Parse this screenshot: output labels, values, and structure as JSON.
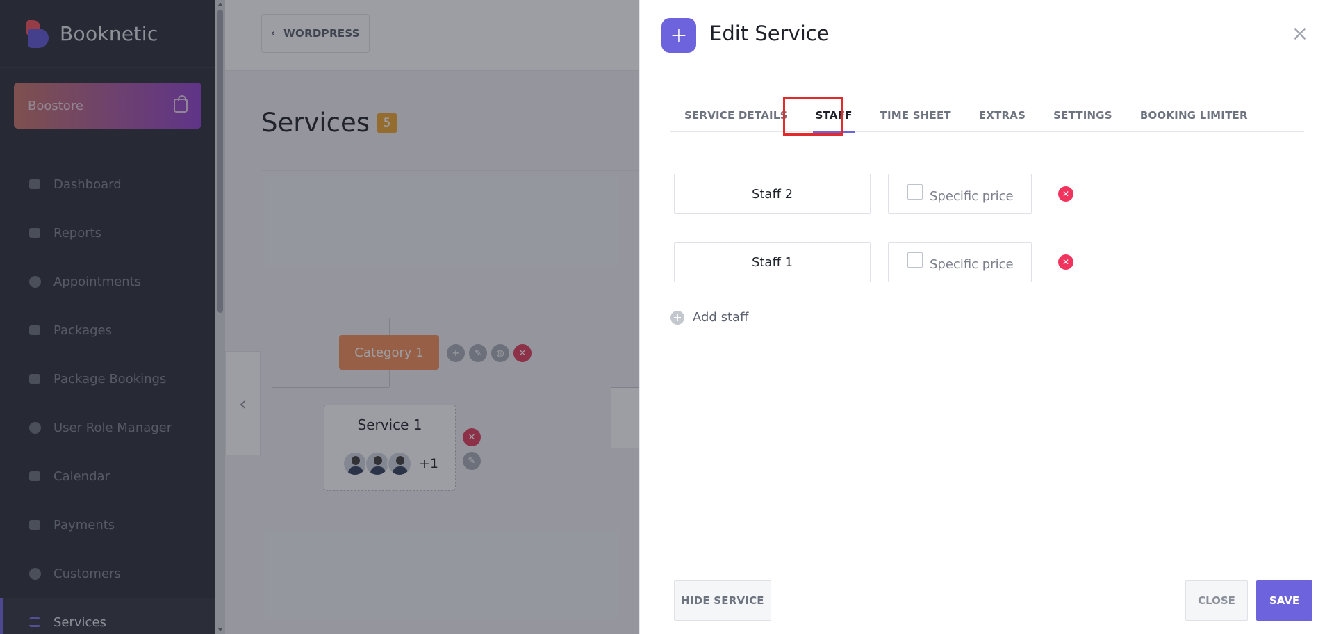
{
  "sidebar": {
    "brand": "Booknetic",
    "boostore_label": "Boostore",
    "items": [
      {
        "label": "Dashboard",
        "icon": "cube-icon"
      },
      {
        "label": "Reports",
        "icon": "chart-icon"
      },
      {
        "label": "Appointments",
        "icon": "clock-icon"
      },
      {
        "label": "Packages",
        "icon": "boxes-icon"
      },
      {
        "label": "Package Bookings",
        "icon": "box-icon"
      },
      {
        "label": "User Role Manager",
        "icon": "user-plus-icon"
      },
      {
        "label": "Calendar",
        "icon": "calendar-icon"
      },
      {
        "label": "Payments",
        "icon": "wallet-icon"
      },
      {
        "label": "Customers",
        "icon": "users-icon"
      },
      {
        "label": "Services",
        "icon": "list-icon"
      }
    ]
  },
  "background": {
    "wordpress_label": "WORDPRESS",
    "page_title": "Services",
    "count": "5",
    "category_label": "Category 1",
    "service_name": "Service 1",
    "extra_staff": "+1"
  },
  "panel": {
    "title": "Edit Service",
    "tabs": [
      "SERVICE DETAILS",
      "STAFF",
      "TIME SHEET",
      "EXTRAS",
      "SETTINGS",
      "BOOKING LIMITER"
    ],
    "staff_rows": [
      {
        "name": "Staff 2",
        "price_label": "Specific price"
      },
      {
        "name": "Staff 1",
        "price_label": "Specific price"
      }
    ],
    "add_staff_label": "Add staff",
    "hide_service_label": "HIDE SERVICE",
    "close_label": "CLOSE",
    "save_label": "SAVE"
  },
  "colors": {
    "accent": "#6c63dd",
    "danger": "#f0345e",
    "category": "#f58e57",
    "highlight": "#e32b2b"
  }
}
